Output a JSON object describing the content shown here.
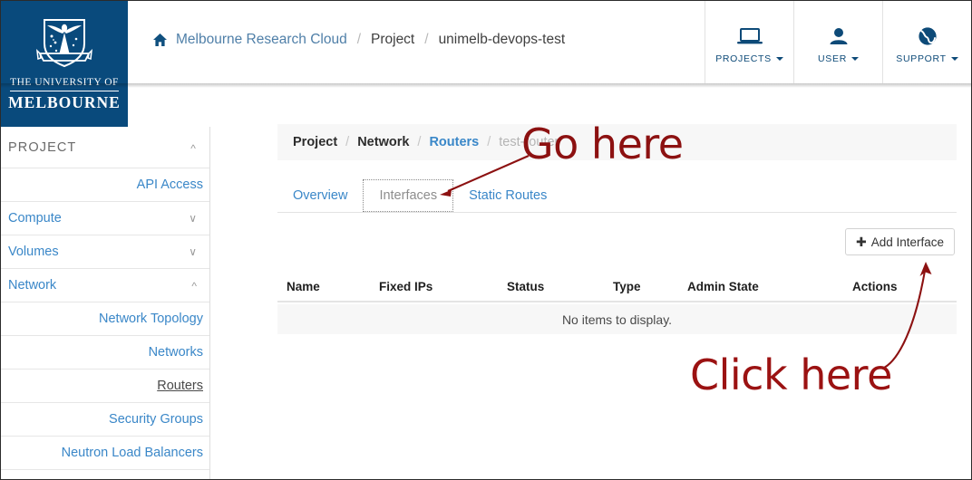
{
  "header": {
    "logo": {
      "line1": "THE UNIVERSITY OF",
      "line2": "MELBOURNE",
      "icon": "university-crest-icon"
    },
    "breadcrumb": {
      "home_icon": "home-icon",
      "items": [
        {
          "label": "Melbourne Research Cloud",
          "type": "link"
        },
        {
          "label": "Project",
          "type": "text"
        },
        {
          "label": "unimelb-devops-test",
          "type": "text"
        }
      ],
      "separator": "/"
    },
    "actions": [
      {
        "label": "PROJECTS",
        "icon": "laptop-icon",
        "caret": true
      },
      {
        "label": "USER",
        "icon": "user-icon",
        "caret": true
      },
      {
        "label": "SUPPORT",
        "icon": "globe-icon",
        "caret": true
      }
    ]
  },
  "sidebar": {
    "title": "PROJECT",
    "title_chevron": "chevron-up-icon",
    "items": [
      {
        "label": "API Access",
        "level": 2,
        "chevron": null,
        "active": false
      },
      {
        "label": "Compute",
        "level": 1,
        "chevron": "chevron-down-icon",
        "active": false
      },
      {
        "label": "Volumes",
        "level": 1,
        "chevron": "chevron-down-icon",
        "active": false
      },
      {
        "label": "Network",
        "level": 1,
        "chevron": "chevron-up-icon",
        "active": false
      },
      {
        "label": "Network Topology",
        "level": 2,
        "chevron": null,
        "active": false
      },
      {
        "label": "Networks",
        "level": 2,
        "chevron": null,
        "active": false
      },
      {
        "label": "Routers",
        "level": 2,
        "chevron": null,
        "active": true
      },
      {
        "label": "Security Groups",
        "level": 2,
        "chevron": null,
        "active": false
      },
      {
        "label": "Neutron Load Balancers",
        "level": 2,
        "chevron": null,
        "active": false
      }
    ]
  },
  "main": {
    "breadcrumb": {
      "separator": "/",
      "items": [
        {
          "label": "Project",
          "type": "strong"
        },
        {
          "label": "Network",
          "type": "strong"
        },
        {
          "label": "Routers",
          "type": "link"
        },
        {
          "label": "test-router",
          "type": "current"
        }
      ]
    },
    "tabs": [
      {
        "label": "Overview",
        "selected": false
      },
      {
        "label": "Interfaces",
        "selected": true
      },
      {
        "label": "Static Routes",
        "selected": false
      }
    ],
    "add_button": {
      "label": "Add Interface",
      "icon": "plus-icon"
    },
    "table": {
      "columns": [
        "Name",
        "Fixed IPs",
        "Status",
        "Type",
        "Admin State",
        "Actions"
      ],
      "rows": [],
      "empty_message": "No items to display."
    }
  },
  "annotations": [
    {
      "text": "Go here",
      "color": "#8c1111",
      "points_to": "tab-interfaces"
    },
    {
      "text": "Click here",
      "color": "#9b1212",
      "points_to": "add-interface-button"
    }
  ],
  "colors": {
    "brand_navy": "#094a7c",
    "link_blue": "#3a87c8",
    "header_link": "#4f7fa8",
    "annotation_red": "#8c1111",
    "panel_grey": "#f7f7f7"
  }
}
